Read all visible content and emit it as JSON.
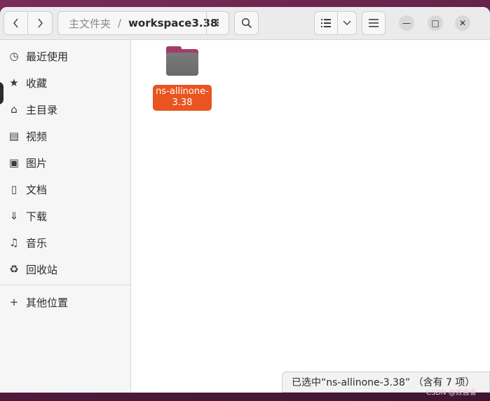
{
  "header": {
    "back_icon": "chevron-left-icon",
    "forward_icon": "chevron-right-icon",
    "path_home": "主文件夹",
    "path_separator": "/",
    "path_current": "workspace3.38",
    "path_menu_glyph": "⋮",
    "search_icon": "search-icon",
    "list_view_icon": "list-view-icon",
    "view_dropdown_icon": "chevron-down-icon",
    "menu_icon": "hamburger-menu-icon",
    "minimize_glyph": "—",
    "maximize_glyph": "□",
    "close_glyph": "✕"
  },
  "sidebar": {
    "items": [
      {
        "label": "最近使用",
        "icon": "clock-icon",
        "glyph": "◷"
      },
      {
        "label": "收藏",
        "icon": "star-icon",
        "glyph": "★"
      },
      {
        "label": "主目录",
        "icon": "home-icon",
        "glyph": "⌂"
      },
      {
        "label": "视频",
        "icon": "video-icon",
        "glyph": "▤"
      },
      {
        "label": "图片",
        "icon": "image-icon",
        "glyph": "▣"
      },
      {
        "label": "文档",
        "icon": "document-icon",
        "glyph": "▯"
      },
      {
        "label": "下载",
        "icon": "download-icon",
        "glyph": "⇓"
      },
      {
        "label": "音乐",
        "icon": "music-icon",
        "glyph": "♫"
      },
      {
        "label": "回收站",
        "icon": "trash-icon",
        "glyph": "♻"
      }
    ],
    "other_locations": {
      "label": "其他位置",
      "icon": "plus-icon",
      "glyph": "+"
    }
  },
  "main": {
    "folder": {
      "name": "ns-allinone-3.38",
      "icon": "folder-icon",
      "selected": true
    }
  },
  "status": {
    "text": "已选中“ns-allinone-3.38” （含有 7 项）"
  },
  "watermark": "CSDN @败自奋",
  "colors": {
    "accent": "#e95420",
    "folder_tab": "#a33c6b",
    "folder_body": "#6f6f6f",
    "desktop": "#5b1f45"
  }
}
